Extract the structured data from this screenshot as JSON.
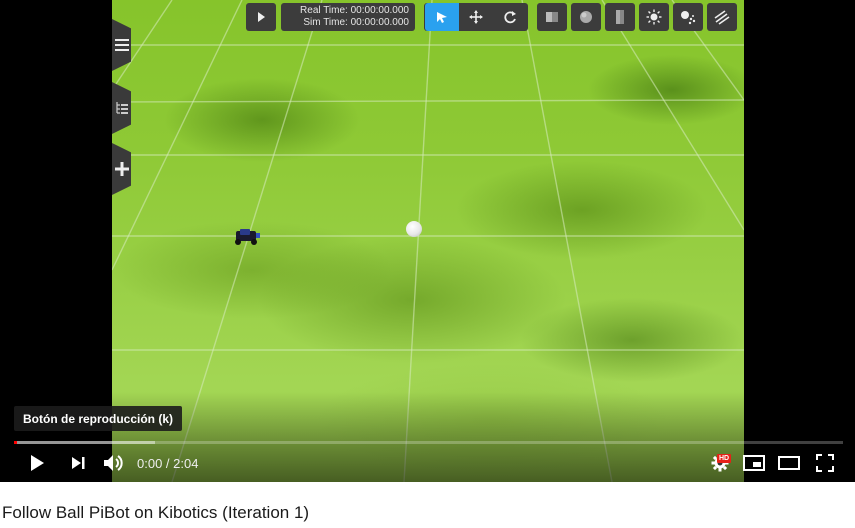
{
  "gz_toolbar": {
    "real_time": "Real Time: 00:00:00.000",
    "sim_time": "Sim Time: 00:00:00.000",
    "icons": [
      "play-icon",
      "select-arrow-icon",
      "translate-icon",
      "rotate-icon",
      "box-icon",
      "sphere-icon",
      "cylinder-icon",
      "point-light-icon",
      "spot-light-icon",
      "directional-light-icon"
    ],
    "active_color": "#2aa1ef"
  },
  "side_menu": {
    "icons": [
      "hamburger-icon",
      "tree-icon",
      "plus-icon"
    ]
  },
  "player": {
    "tooltip": "Botón de reproducción (k)",
    "current_time": "0:00",
    "separator": " / ",
    "duration": "2:04",
    "time_text": "0:00 / 2:04",
    "buffered_fraction": 0.17,
    "played_fraction": 0.0,
    "hd_badge": "HD",
    "progress_color": "#ff0000"
  },
  "video": {
    "title": "Follow Ball PiBot on Kibotics (Iteration 1)"
  }
}
